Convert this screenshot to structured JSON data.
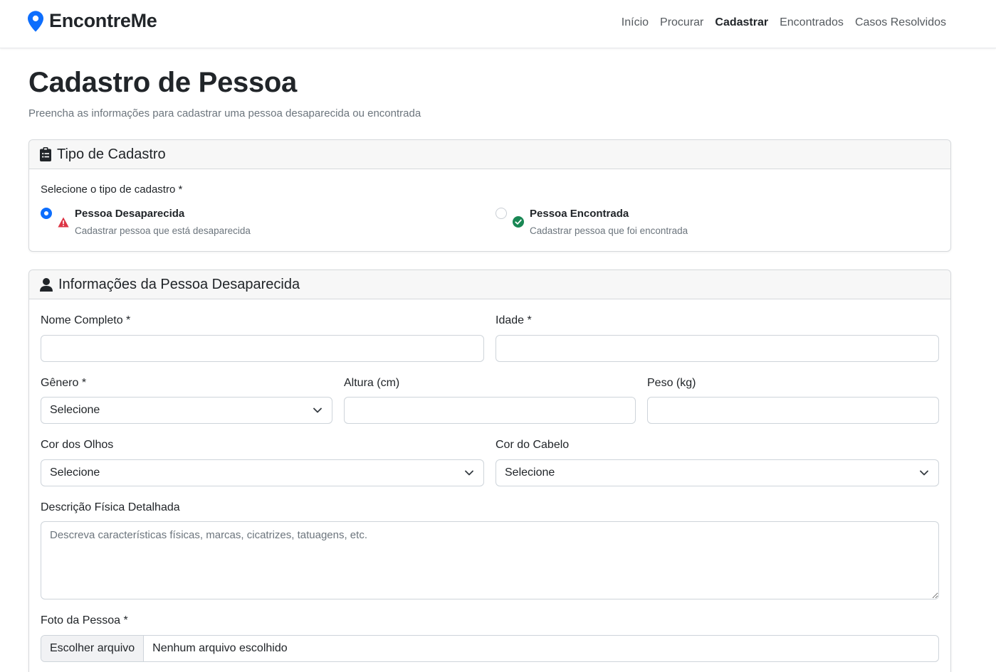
{
  "brand": {
    "name": "EncontreMe",
    "icon": "map-pin-icon",
    "icon_color": "#0d6efd"
  },
  "nav": [
    {
      "label": "Início",
      "active": false
    },
    {
      "label": "Procurar",
      "active": false
    },
    {
      "label": "Cadastrar",
      "active": true
    },
    {
      "label": "Encontrados",
      "active": false
    },
    {
      "label": "Casos Resolvidos",
      "active": false
    }
  ],
  "page": {
    "title": "Cadastro de Pessoa",
    "subtitle": "Preencha as informações para cadastrar uma pessoa desaparecida ou encontrada"
  },
  "tipo_card": {
    "title": "Tipo de Cadastro",
    "icon": "clipboard-icon",
    "question": "Selecione o tipo de cadastro *",
    "options": [
      {
        "title": "Pessoa Desaparecida",
        "desc": "Cadastrar pessoa que está desaparecida",
        "icon": "warning-triangle-icon",
        "icon_color": "#dc3545",
        "checked": true
      },
      {
        "title": "Pessoa Encontrada",
        "desc": "Cadastrar pessoa que foi encontrada",
        "icon": "check-circle-icon",
        "icon_color": "#198754",
        "checked": false
      }
    ]
  },
  "info_card": {
    "title": "Informações da Pessoa Desaparecida",
    "icon": "user-icon",
    "fields": {
      "nome": {
        "label": "Nome Completo *",
        "value": ""
      },
      "idade": {
        "label": "Idade *",
        "value": ""
      },
      "genero": {
        "label": "Gênero *",
        "value": "Selecione"
      },
      "altura": {
        "label": "Altura (cm)",
        "value": ""
      },
      "peso": {
        "label": "Peso (kg)",
        "value": ""
      },
      "olhos": {
        "label": "Cor dos Olhos",
        "value": "Selecione"
      },
      "cabelo": {
        "label": "Cor do Cabelo",
        "value": "Selecione"
      },
      "descricao": {
        "label": "Descrição Física Detalhada",
        "placeholder": "Descreva características físicas, marcas, cicatrizes, tatuagens, etc."
      },
      "foto": {
        "label": "Foto da Pessoa *",
        "button": "Escolher arquivo",
        "status": "Nenhum arquivo escolhido"
      }
    }
  },
  "colors": {
    "accent": "#0d6efd",
    "danger": "#dc3545",
    "success": "#198754",
    "muted": "#6c757d"
  }
}
